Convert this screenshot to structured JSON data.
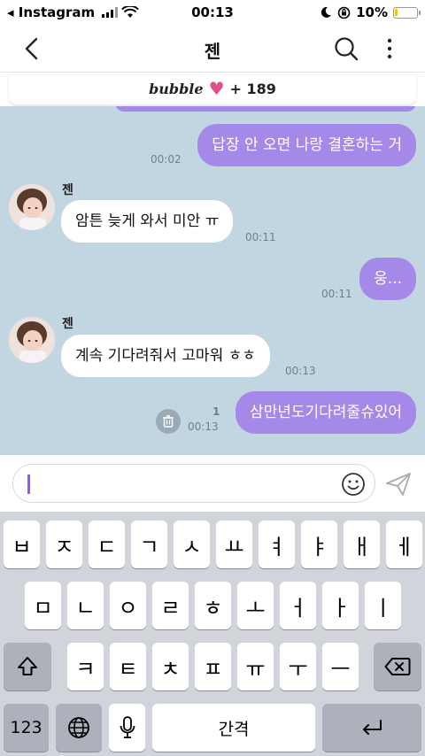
{
  "status_bar": {
    "carrier": "◂ Instagram",
    "time": "00:13",
    "battery": "10%"
  },
  "header": {
    "title": "젠"
  },
  "banner": {
    "brand": "bubble",
    "count": "+ 189"
  },
  "messages": [
    {
      "id": "m1",
      "side": "me",
      "text": "답장 안 오면 나랑 결혼하는 거",
      "time": "00:02"
    },
    {
      "id": "m2",
      "side": "them",
      "sender": "젠",
      "text": "암튼 늦게 와서 미안 ㅠ",
      "time": "00:11"
    },
    {
      "id": "m3",
      "side": "me",
      "text": "웅...",
      "time": "00:11"
    },
    {
      "id": "m4",
      "side": "them",
      "sender": "젠",
      "text": "계속 기다려줘서 고마워 ㅎㅎ",
      "time": "00:13"
    },
    {
      "id": "m5",
      "side": "me",
      "text": "삼만년도기다려줄슈있어",
      "time": "00:13",
      "unread": "1"
    }
  ],
  "keyboard": {
    "row1": [
      "ㅂ",
      "ㅈ",
      "ㄷ",
      "ㄱ",
      "ㅅ",
      "ㅛ",
      "ㅕ",
      "ㅑ",
      "ㅐ",
      "ㅔ"
    ],
    "row2": [
      "ㅁ",
      "ㄴ",
      "ㅇ",
      "ㄹ",
      "ㅎ",
      "ㅗ",
      "ㅓ",
      "ㅏ",
      "ㅣ"
    ],
    "row3": [
      "ㅋ",
      "ㅌ",
      "ㅊ",
      "ㅍ",
      "ㅠ",
      "ㅜ",
      "ㅡ"
    ],
    "numbers_label": "123",
    "space_label": "간격"
  },
  "colors": {
    "chat_bg": "#c2d6e1",
    "my_bubble": "#a489e8",
    "their_bubble": "#ffffff",
    "caret": "#8b5cf6"
  },
  "icons": {
    "back": "chevron-left-icon",
    "search": "search-icon",
    "more": "more-vertical-icon",
    "emoji": "smiley-icon",
    "send": "paper-plane-icon",
    "delete": "trash-icon",
    "shift": "shift-icon",
    "backspace": "backspace-icon",
    "globe": "globe-icon",
    "mic": "microphone-icon",
    "return": "return-icon"
  }
}
